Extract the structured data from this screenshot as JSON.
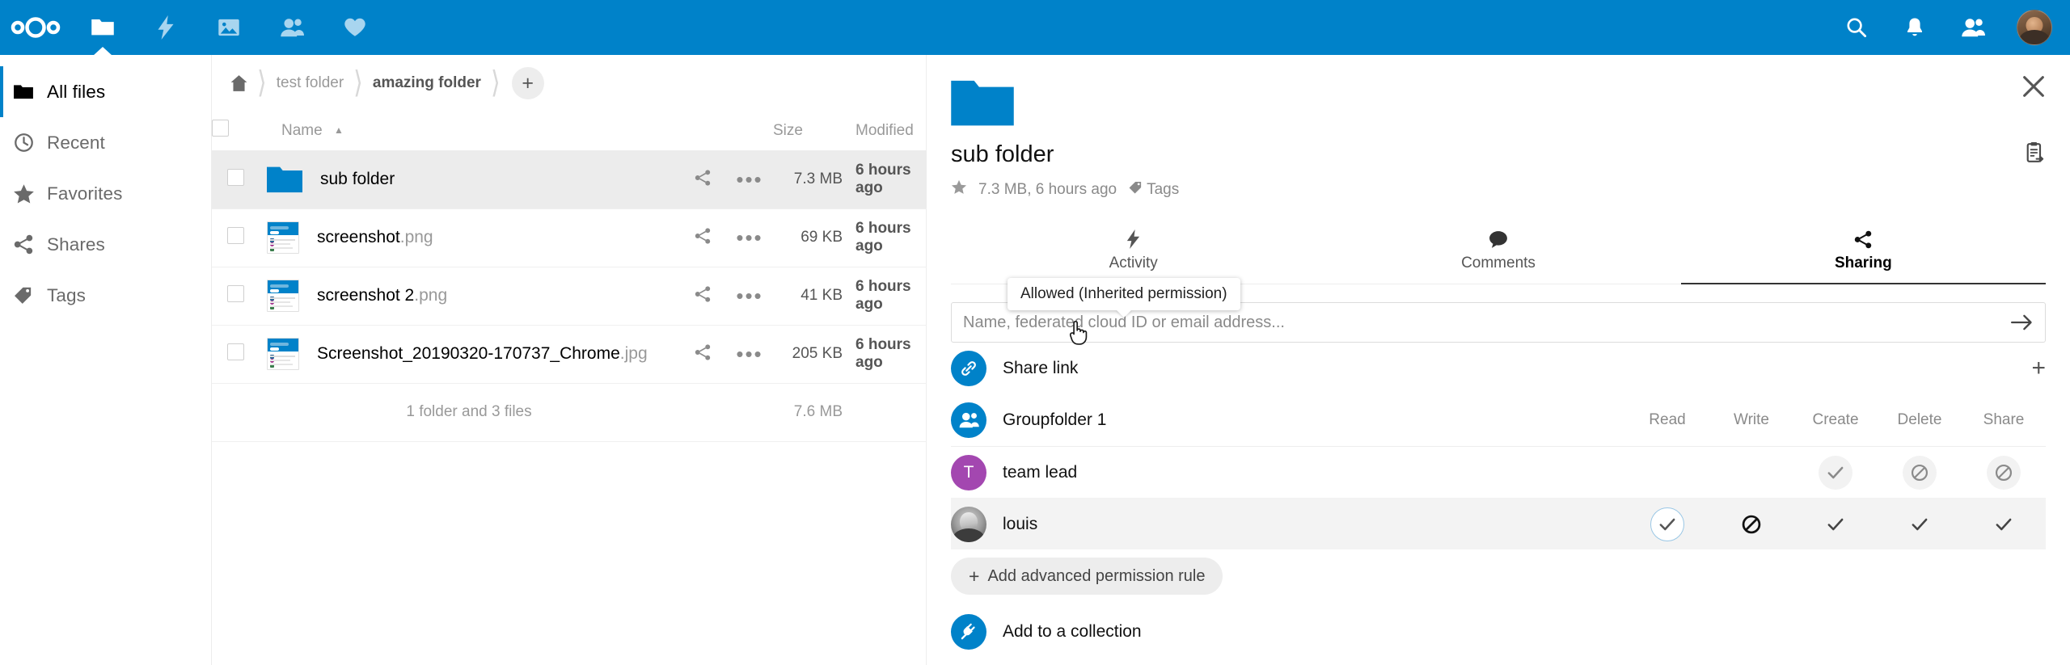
{
  "topbar": {
    "logo_name": "nextcloud-logo",
    "apps": [
      {
        "name": "files-app",
        "icon": "folder-icon",
        "active": true
      },
      {
        "name": "activity-app",
        "icon": "lightning-icon",
        "active": false
      },
      {
        "name": "photos-app",
        "icon": "image-icon",
        "active": false
      },
      {
        "name": "contacts-app",
        "icon": "contacts-icon",
        "active": false
      },
      {
        "name": "favorites-app",
        "icon": "heart-icon",
        "active": false
      }
    ],
    "right_icons": [
      {
        "name": "search-icon"
      },
      {
        "name": "notifications-bell-icon"
      },
      {
        "name": "contacts-menu-icon"
      }
    ],
    "accent": "#0082c9"
  },
  "sidebar": {
    "items": [
      {
        "label": "All files",
        "icon": "folder-icon",
        "active": true
      },
      {
        "label": "Recent",
        "icon": "clock-icon",
        "active": false
      },
      {
        "label": "Favorites",
        "icon": "star-icon",
        "active": false
      },
      {
        "label": "Shares",
        "icon": "share-icon",
        "active": false
      },
      {
        "label": "Tags",
        "icon": "tag-icon",
        "active": false
      }
    ]
  },
  "breadcrumb": {
    "home_icon": "home-icon",
    "crumbs": [
      {
        "label": "test folder",
        "current": false
      },
      {
        "label": "amazing folder",
        "current": true
      }
    ],
    "add_label": "+"
  },
  "filelist": {
    "headers": {
      "name": "Name",
      "size": "Size",
      "modified": "Modified"
    },
    "sort_caret": "▲",
    "rows": [
      {
        "name": "sub folder",
        "ext": "",
        "type": "folder",
        "size": "7.3 MB",
        "modified": "6 hours ago",
        "selected": true
      },
      {
        "name": "screenshot",
        "ext": ".png",
        "type": "image",
        "size": "69 KB",
        "modified": "6 hours ago",
        "selected": false
      },
      {
        "name": "screenshot 2",
        "ext": ".png",
        "type": "image",
        "size": "41 KB",
        "modified": "6 hours ago",
        "selected": false
      },
      {
        "name": "Screenshot_20190320-170737_Chrome",
        "ext": ".jpg",
        "type": "image",
        "size": "205 KB",
        "modified": "6 hours ago",
        "selected": false
      }
    ],
    "summary_text": "1 folder and 3 files",
    "summary_size": "7.6 MB"
  },
  "detail": {
    "close_icon": "close-icon",
    "preview_icon": "folder-icon",
    "title": "sub folder",
    "copy_icon": "copy-internal-link-icon",
    "meta_star_icon": "star-icon",
    "meta_text": "7.3 MB, 6 hours ago",
    "meta_tag_icon": "tag-icon",
    "meta_tags_label": "Tags",
    "tabs": [
      {
        "label": "Activity",
        "icon": "lightning-icon",
        "active": false
      },
      {
        "label": "Comments",
        "icon": "comment-icon",
        "active": false
      },
      {
        "label": "Sharing",
        "icon": "share-icon",
        "active": true
      }
    ],
    "sharing": {
      "input_placeholder": "Name, federated cloud ID or email address...",
      "input_value": "",
      "submit_icon": "arrow-right-icon",
      "share_link": {
        "label": "Share link",
        "icon": "link-icon",
        "add_icon": "+"
      },
      "groupfolder": {
        "label": "Groupfolder 1",
        "icon": "group-icon"
      },
      "permission_columns": [
        "Read",
        "Write",
        "Create",
        "Delete",
        "Share"
      ],
      "permission_rows": [
        {
          "name": "team lead",
          "avatar_type": "initial",
          "avatar_initial": "T",
          "avatar_color": "#a347b0",
          "highlight": false,
          "cells": [
            {
              "state": "hidden",
              "icon": ""
            },
            {
              "state": "hidden",
              "icon": ""
            },
            {
              "state": "muted",
              "icon": "check"
            },
            {
              "state": "muted",
              "icon": "denied"
            },
            {
              "state": "muted",
              "icon": "denied"
            }
          ]
        },
        {
          "name": "louis",
          "avatar_type": "photo",
          "avatar_initial": "",
          "avatar_color": "",
          "highlight": true,
          "cells": [
            {
              "state": "focus",
              "icon": "check"
            },
            {
              "state": "dark",
              "icon": "denied"
            },
            {
              "state": "plain",
              "icon": "check"
            },
            {
              "state": "plain",
              "icon": "check"
            },
            {
              "state": "plain",
              "icon": "check"
            }
          ]
        }
      ],
      "tooltip": {
        "text": "Allowed (Inherited permission)"
      },
      "add_rule": {
        "label": "Add advanced permission rule",
        "plus": "+"
      },
      "add_collection": {
        "label": "Add to a collection",
        "icon": "plug-icon"
      }
    }
  }
}
